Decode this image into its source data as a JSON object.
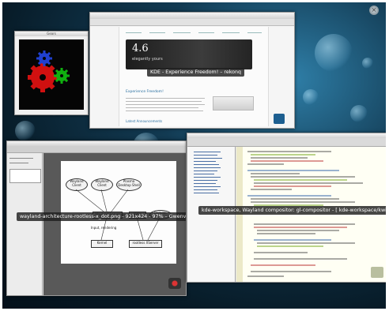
{
  "screen": {
    "accent": "#1a5f86"
  },
  "windows": {
    "gears": {
      "title": "Gears",
      "colors": [
        "#d01010",
        "#2040d0",
        "#10b010"
      ]
    },
    "browser": {
      "title": "KDE - Experience Freedom! - rekonq",
      "caption": "KDE - Experience Freedom! – rekonq",
      "hero_version": "4.6",
      "hero_tagline": "elegantly yours",
      "section_heading": "Experience Freedom!",
      "footer_link": "Latest Announcements"
    },
    "gwenview": {
      "caption": "wayland-architecture-rootless-x_dot.png - 921x424 - 97% – Gwenview",
      "nodes": {
        "wayland_client_1": "Wayland Client",
        "wayland_client_2": "Wayland Client",
        "plasma": "Plasma Desktop Shell",
        "wayland_server": "Wayland Server",
        "input_rendering": "Input, rendering",
        "kernel": "Kernel",
        "rootless_x": "rootless XServer",
        "kwin": "KWin",
        "remote": "Remote"
      }
    },
    "kdevelop": {
      "caption": "kde-workspace, Wayland compositor: gl-compositor - [ kde-workspace/kwin/..."
    }
  }
}
